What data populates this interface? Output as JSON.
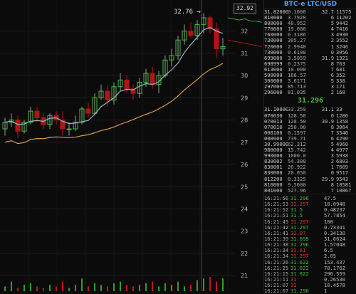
{
  "title": "BTC-e LTC/USD",
  "crosshair_price": "32.92",
  "top_marker": "32.76 →",
  "y_axis_labels": [
    "32",
    "31",
    "30",
    "29",
    "28",
    "27",
    "26",
    "25",
    "24",
    "23",
    "22",
    "21"
  ],
  "colors": {
    "up": "#3ec23e",
    "down": "#b01414",
    "ma_fast": "#9bb6c8",
    "ma_slow": "#d69a4a",
    "vol_up": "#2f9e2f",
    "vol_down": "#c21818",
    "ask_line": "#b01414",
    "bid_line": "#2fae2f"
  },
  "chart_data": {
    "type": "candlestick",
    "y_axis": {
      "min": 20.3,
      "max": 33.4
    },
    "candles": [
      [
        27.6,
        28.1,
        27.3,
        27.9
      ],
      [
        27.9,
        28.3,
        27.7,
        28.0
      ],
      [
        28.0,
        28.2,
        27.2,
        27.5
      ],
      [
        27.5,
        28.0,
        27.4,
        27.9
      ],
      [
        27.9,
        28.6,
        27.8,
        28.4
      ],
      [
        28.4,
        28.6,
        27.9,
        28.1
      ],
      [
        28.1,
        28.3,
        27.6,
        27.8
      ],
      [
        27.8,
        28.3,
        27.6,
        28.2
      ],
      [
        28.2,
        28.4,
        27.8,
        28.0
      ],
      [
        28.0,
        28.4,
        27.3,
        27.6
      ],
      [
        27.6,
        27.9,
        27.3,
        27.6
      ],
      [
        27.6,
        28.2,
        27.5,
        27.9
      ],
      [
        27.9,
        28.6,
        27.8,
        28.5
      ],
      [
        28.5,
        28.8,
        28.1,
        28.3
      ],
      [
        28.3,
        29.2,
        28.2,
        29.0
      ],
      [
        29.0,
        29.6,
        28.9,
        29.3
      ],
      [
        29.3,
        29.6,
        28.6,
        28.9
      ],
      [
        28.9,
        29.7,
        28.7,
        29.5
      ],
      [
        29.5,
        30.1,
        29.3,
        29.8
      ],
      [
        29.8,
        30.0,
        29.2,
        29.4
      ],
      [
        29.4,
        29.6,
        28.9,
        29.2
      ],
      [
        29.2,
        29.9,
        29.0,
        29.7
      ],
      [
        29.7,
        30.3,
        29.5,
        30.1
      ],
      [
        30.1,
        30.4,
        29.4,
        29.6
      ],
      [
        29.6,
        30.2,
        29.2,
        30.0
      ],
      [
        30.0,
        30.9,
        29.9,
        30.7
      ],
      [
        30.7,
        31.2,
        30.4,
        30.9
      ],
      [
        30.9,
        31.8,
        30.7,
        31.6
      ],
      [
        31.6,
        32.3,
        31.4,
        32.0
      ],
      [
        32.0,
        32.4,
        31.7,
        31.8
      ],
      [
        31.8,
        32.5,
        31.6,
        32.3
      ],
      [
        32.3,
        32.8,
        31.9,
        32.6
      ],
      [
        32.6,
        32.7,
        31.9,
        32.1
      ],
      [
        32.1,
        32.4,
        30.8,
        31.2
      ],
      [
        31.2,
        31.7,
        30.9,
        31.3
      ]
    ],
    "volumes": [
      3,
      6,
      2,
      4,
      5,
      3,
      2,
      4,
      3,
      6,
      2,
      4,
      8,
      3,
      5,
      4,
      3,
      5,
      6,
      4,
      3,
      4,
      5,
      6,
      3,
      5,
      4,
      6,
      3,
      4,
      7,
      8,
      9,
      6,
      8
    ],
    "ask_line": [
      [
        0,
        32.6
      ],
      [
        1,
        32.55
      ],
      [
        2,
        32.5
      ],
      [
        3,
        32.55
      ],
      [
        4,
        32.45
      ],
      [
        5,
        32.45
      ],
      [
        6,
        32.4
      ]
    ],
    "bid_line": [
      [
        0,
        31.6
      ],
      [
        1,
        31.55
      ],
      [
        2,
        31.5
      ],
      [
        3,
        31.45
      ],
      [
        4,
        31.4
      ],
      [
        5,
        31.35
      ],
      [
        6,
        31.3
      ]
    ]
  },
  "orderbook": {
    "asks": [
      [
        "31.82",
        "0000",
        "0.1000",
        "32.7",
        "11575"
      ],
      [
        "81",
        "0000",
        "3.7920",
        "6",
        "11202"
      ],
      [
        "80",
        "0000",
        "40.952",
        "5",
        "9442"
      ],
      [
        "77",
        "0000",
        "19.000",
        "4",
        "7416"
      ],
      [
        "76",
        "0000",
        "0.3186",
        "3",
        "4930"
      ],
      [
        "73",
        "0000",
        "305.27",
        "2",
        "3552"
      ],
      [
        "72",
        "0000",
        "2.9940",
        "1",
        "3246"
      ],
      [
        "73",
        "0000",
        "0.6100",
        "0",
        "3056"
      ],
      [
        "69",
        "9000",
        "3.5059",
        "31.9",
        "1921"
      ],
      [
        "69",
        "8999",
        "0.2375",
        "8",
        "763"
      ],
      [
        "61",
        "3000",
        "10.000",
        "7",
        "681"
      ],
      [
        "50",
        "0000",
        "166.57",
        "6",
        "352"
      ],
      [
        "30",
        "0000",
        "3.6171",
        "5",
        "338"
      ],
      [
        "29",
        "7000",
        "85.713",
        "3",
        "171"
      ],
      [
        "29",
        "6000",
        "81.035",
        "2",
        "168"
      ]
    ],
    "last": "31.296",
    "bids": [
      [
        "31.1",
        "000000",
        "33.259",
        "31.1",
        "33"
      ],
      [
        "07",
        "0030",
        "128.50",
        "0",
        "1280"
      ],
      [
        "07",
        "0013",
        "128.50",
        "30.9",
        "1358"
      ],
      [
        "07",
        "0010",
        "250.00",
        "8",
        "3064"
      ],
      [
        "00",
        "0100",
        "0.1597",
        "7",
        "3540"
      ],
      [
        "00",
        "0000",
        "739.71",
        "6",
        "4290"
      ],
      [
        "30.99",
        "0000",
        "62.312",
        "5",
        "4960"
      ],
      [
        "98",
        "0000",
        "15.742",
        "4",
        "4977"
      ],
      [
        "99",
        "0000",
        "1000.0",
        "3",
        "5938"
      ],
      [
        "83",
        "0002",
        "54.380",
        "2",
        "6803"
      ],
      [
        "83",
        "0001",
        "26.922",
        "1",
        "7609"
      ],
      [
        "83",
        "0000",
        "20.050",
        "0",
        "9517"
      ],
      [
        "81",
        "2200",
        "0.3325",
        "29.9",
        "9543"
      ],
      [
        "81",
        "0000",
        "9.5000",
        "8",
        "10581"
      ],
      [
        "80",
        "1000",
        "527.96",
        "7",
        "10867"
      ]
    ]
  },
  "trades": [
    [
      "16:21:56",
      "31.296",
      "up",
      "47.5"
    ],
    [
      "16:21:53",
      "31.297",
      "down",
      "18.0948"
    ],
    [
      "16:21:52",
      "31.5",
      "up",
      "0.48237"
    ],
    [
      "16:21:51",
      "31.5",
      "up",
      "57.7854"
    ],
    [
      "16:21:45",
      "31.297",
      "down",
      "100"
    ],
    [
      "16:21:42",
      "31.297",
      "up",
      "0.73341"
    ],
    [
      "16:21:41",
      "31.07",
      "down",
      "0.34130"
    ],
    [
      "16:21:39",
      "31.699",
      "up",
      "31.6624"
    ],
    [
      "16:21:38",
      "31.296",
      "up",
      "1.57048"
    ],
    [
      "16:21:34",
      "31.61",
      "down",
      "6.5"
    ],
    [
      "16:21:34",
      "31.297",
      "down",
      "2.05"
    ],
    [
      "16:21:26",
      "31.622",
      "up",
      "153.437"
    ],
    [
      "16:21:25",
      "31.622",
      "up",
      "78.1762"
    ],
    [
      "16:21:15",
      "31.622",
      "up",
      "296.559"
    ],
    [
      "16:21:11",
      "31",
      "down",
      "0.26530"
    ],
    [
      "16:21:07",
      "31",
      "down",
      "10.4578"
    ],
    [
      "16:21:07",
      "31.296",
      "up",
      "1"
    ]
  ]
}
